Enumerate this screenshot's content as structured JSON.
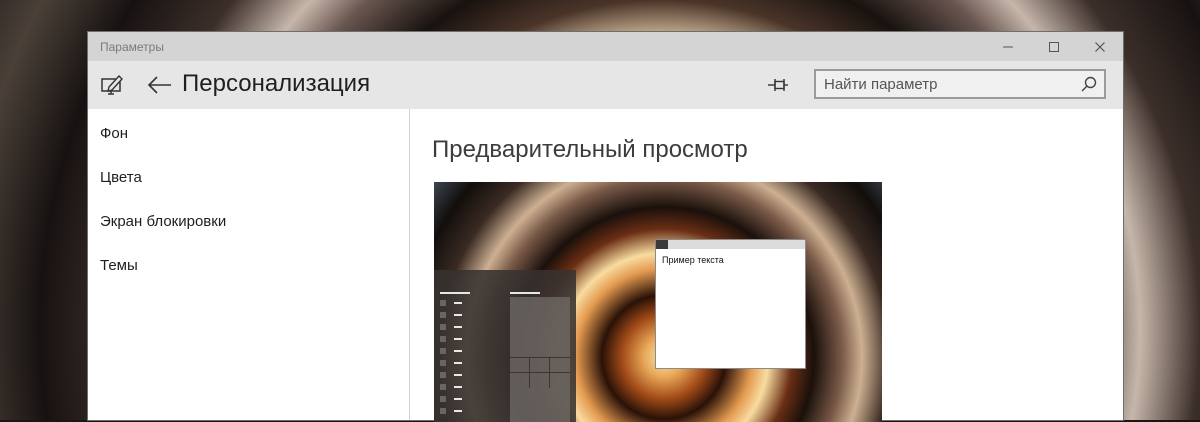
{
  "window": {
    "title": "Параметры",
    "caption": {
      "minimize_icon": "minimize-icon",
      "maximize_icon": "maximize-icon",
      "close_icon": "close-icon"
    }
  },
  "header": {
    "settings_icon": "settings-pen-icon",
    "back_icon": "back-arrow-icon",
    "title": "Персонализация",
    "pin_icon": "pin-icon",
    "search": {
      "placeholder": "Найти параметр",
      "value": "",
      "icon": "search-icon"
    }
  },
  "sidebar": {
    "items": [
      {
        "label": "Фон"
      },
      {
        "label": "Цвета"
      },
      {
        "label": "Экран блокировки"
      },
      {
        "label": "Темы"
      }
    ]
  },
  "main": {
    "section_title": "Предварительный просмотр",
    "preview": {
      "sample_window_text": "Пример текста"
    }
  },
  "colors": {
    "titlebar": "#d4d4d4",
    "header": "#e6e6e6",
    "content": "#ffffff"
  }
}
